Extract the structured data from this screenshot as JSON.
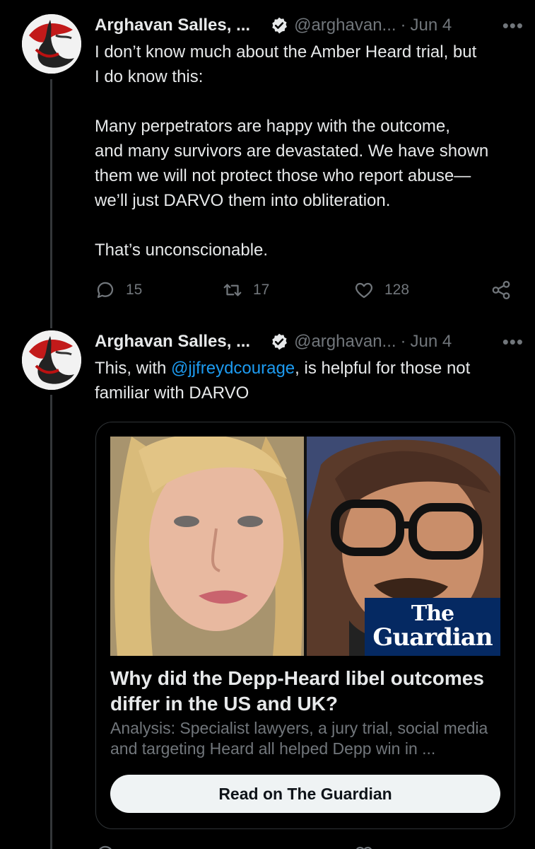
{
  "tweets": [
    {
      "name": "Arghavan Salles, ...",
      "handle": "@arghavan...",
      "separator": "·",
      "date": "Jun 4",
      "more": "•••",
      "text": [
        "I don’t know much about the Amber Heard trial, but",
        "I do know this:",
        "",
        "Many perpetrators are happy with the outcome,",
        "and many survivors are devastated. We have shown",
        "them we will not protect those who report abuse—",
        "we’ll just DARVO them into obliteration.",
        "",
        "That’s unconscionable."
      ],
      "replies": "15",
      "retweets": "17",
      "likes": "128"
    },
    {
      "name": "Arghavan Salles, ...",
      "handle": "@arghavan...",
      "separator": "·",
      "date": "Jun 4",
      "more": "•••",
      "text_before": "This, with ",
      "mention": "@jjfreydcourage",
      "text_after": ", is helpful for those not",
      "text_line2": "familiar with DARVO",
      "card": {
        "brand_line1": "The",
        "brand_line2": "Guardian",
        "title": "Why did the Depp-Heard libel outcomes differ in the US and UK?",
        "description": "Analysis: Specialist lawyers, a jury trial, social media and targeting Heard all helped Depp win in ...",
        "button": "Read on The Guardian"
      }
    }
  ],
  "colors": {
    "background": "#000000",
    "text": "#e7e9ea",
    "muted": "#71767b",
    "link": "#1d9bf0",
    "guardian": "#052962"
  },
  "icons": [
    "verified-badge-icon",
    "more-icon",
    "reply-icon",
    "retweet-icon",
    "like-icon",
    "share-icon"
  ]
}
